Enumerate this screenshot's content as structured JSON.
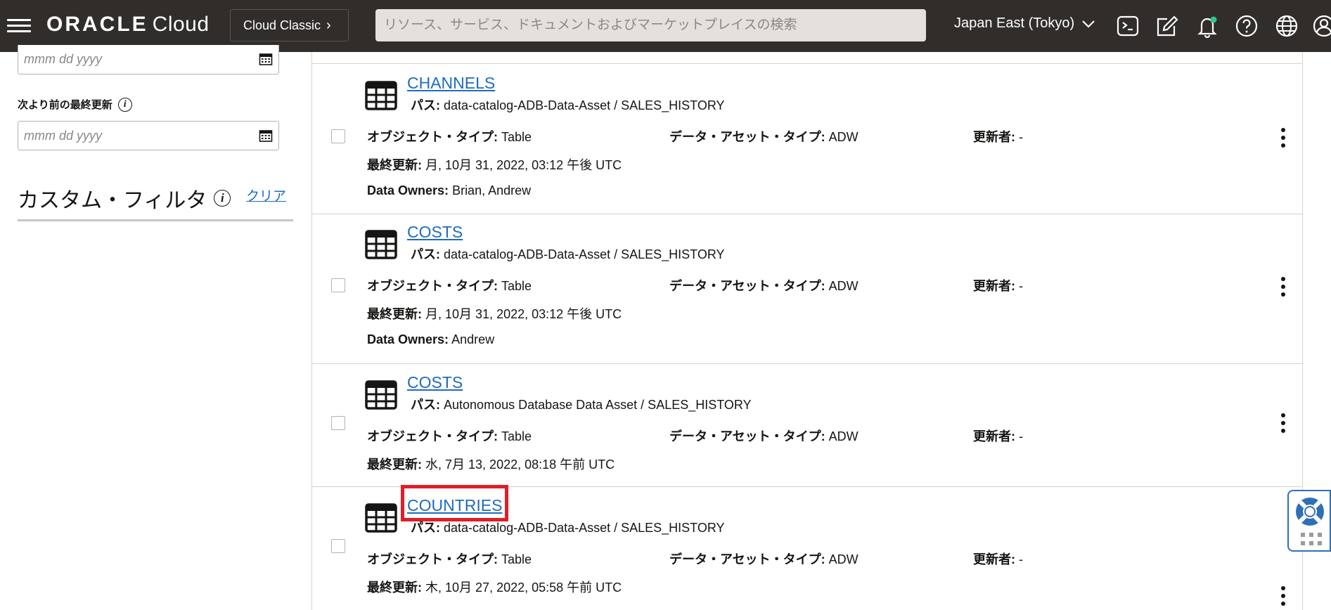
{
  "header": {
    "logo_brand": "ORACLE",
    "logo_product": "Cloud",
    "classic_button": "Cloud Classic",
    "search_placeholder": "リソース、サービス、ドキュメントおよびマーケットプレイスの検索",
    "region": "Japan East (Tokyo)",
    "icons": [
      "cloud-shell-icon",
      "edit-icon",
      "notifications-icon",
      "help-icon",
      "language-icon",
      "profile-icon"
    ],
    "notification_dot_color": "#2dc68b"
  },
  "sidebar": {
    "date_from_placeholder": "mmm dd yyyy",
    "updated_before_label": "次より前の最終更新",
    "date_to_placeholder": "mmm dd yyyy",
    "custom_filter_title": "カスタム・フィルタ",
    "clear_link": "クリア"
  },
  "labels": {
    "path": "パス:",
    "object_type": "オブジェクト・タイプ:",
    "data_asset_type": "データ・アセット・タイプ:",
    "updated_by": "更新者:",
    "last_updated": "最終更新:",
    "data_owners": "Data Owners:"
  },
  "results": [
    {
      "title": "CHANNELS",
      "path": "data-catalog-ADB-Data-Asset / SALES_HISTORY",
      "object_type": "Table",
      "data_asset_type": "ADW",
      "updated_by": "-",
      "last_updated": "月, 10月 31, 2022, 03:12 午後 UTC",
      "data_owners": "Brian, Andrew"
    },
    {
      "title": "COSTS",
      "path": "data-catalog-ADB-Data-Asset / SALES_HISTORY",
      "object_type": "Table",
      "data_asset_type": "ADW",
      "updated_by": "-",
      "last_updated": "月, 10月 31, 2022, 03:12 午後 UTC",
      "data_owners": "Andrew"
    },
    {
      "title": "COSTS",
      "path": "Autonomous Database Data Asset / SALES_HISTORY",
      "object_type": "Table",
      "data_asset_type": "ADW",
      "updated_by": "-",
      "last_updated": "水, 7月 13, 2022, 08:18 午前 UTC"
    },
    {
      "title": "COUNTRIES",
      "path": "data-catalog-ADB-Data-Asset / SALES_HISTORY",
      "object_type": "Table",
      "data_asset_type": "ADW",
      "updated_by": "-",
      "last_updated": "木, 10月 27, 2022, 05:58 午前 UTC"
    }
  ],
  "colors": {
    "topbar": "#312d2a",
    "link": "#1f6bbf",
    "highlight": "#e01e26",
    "help_widget_border": "#2f6fb7"
  }
}
